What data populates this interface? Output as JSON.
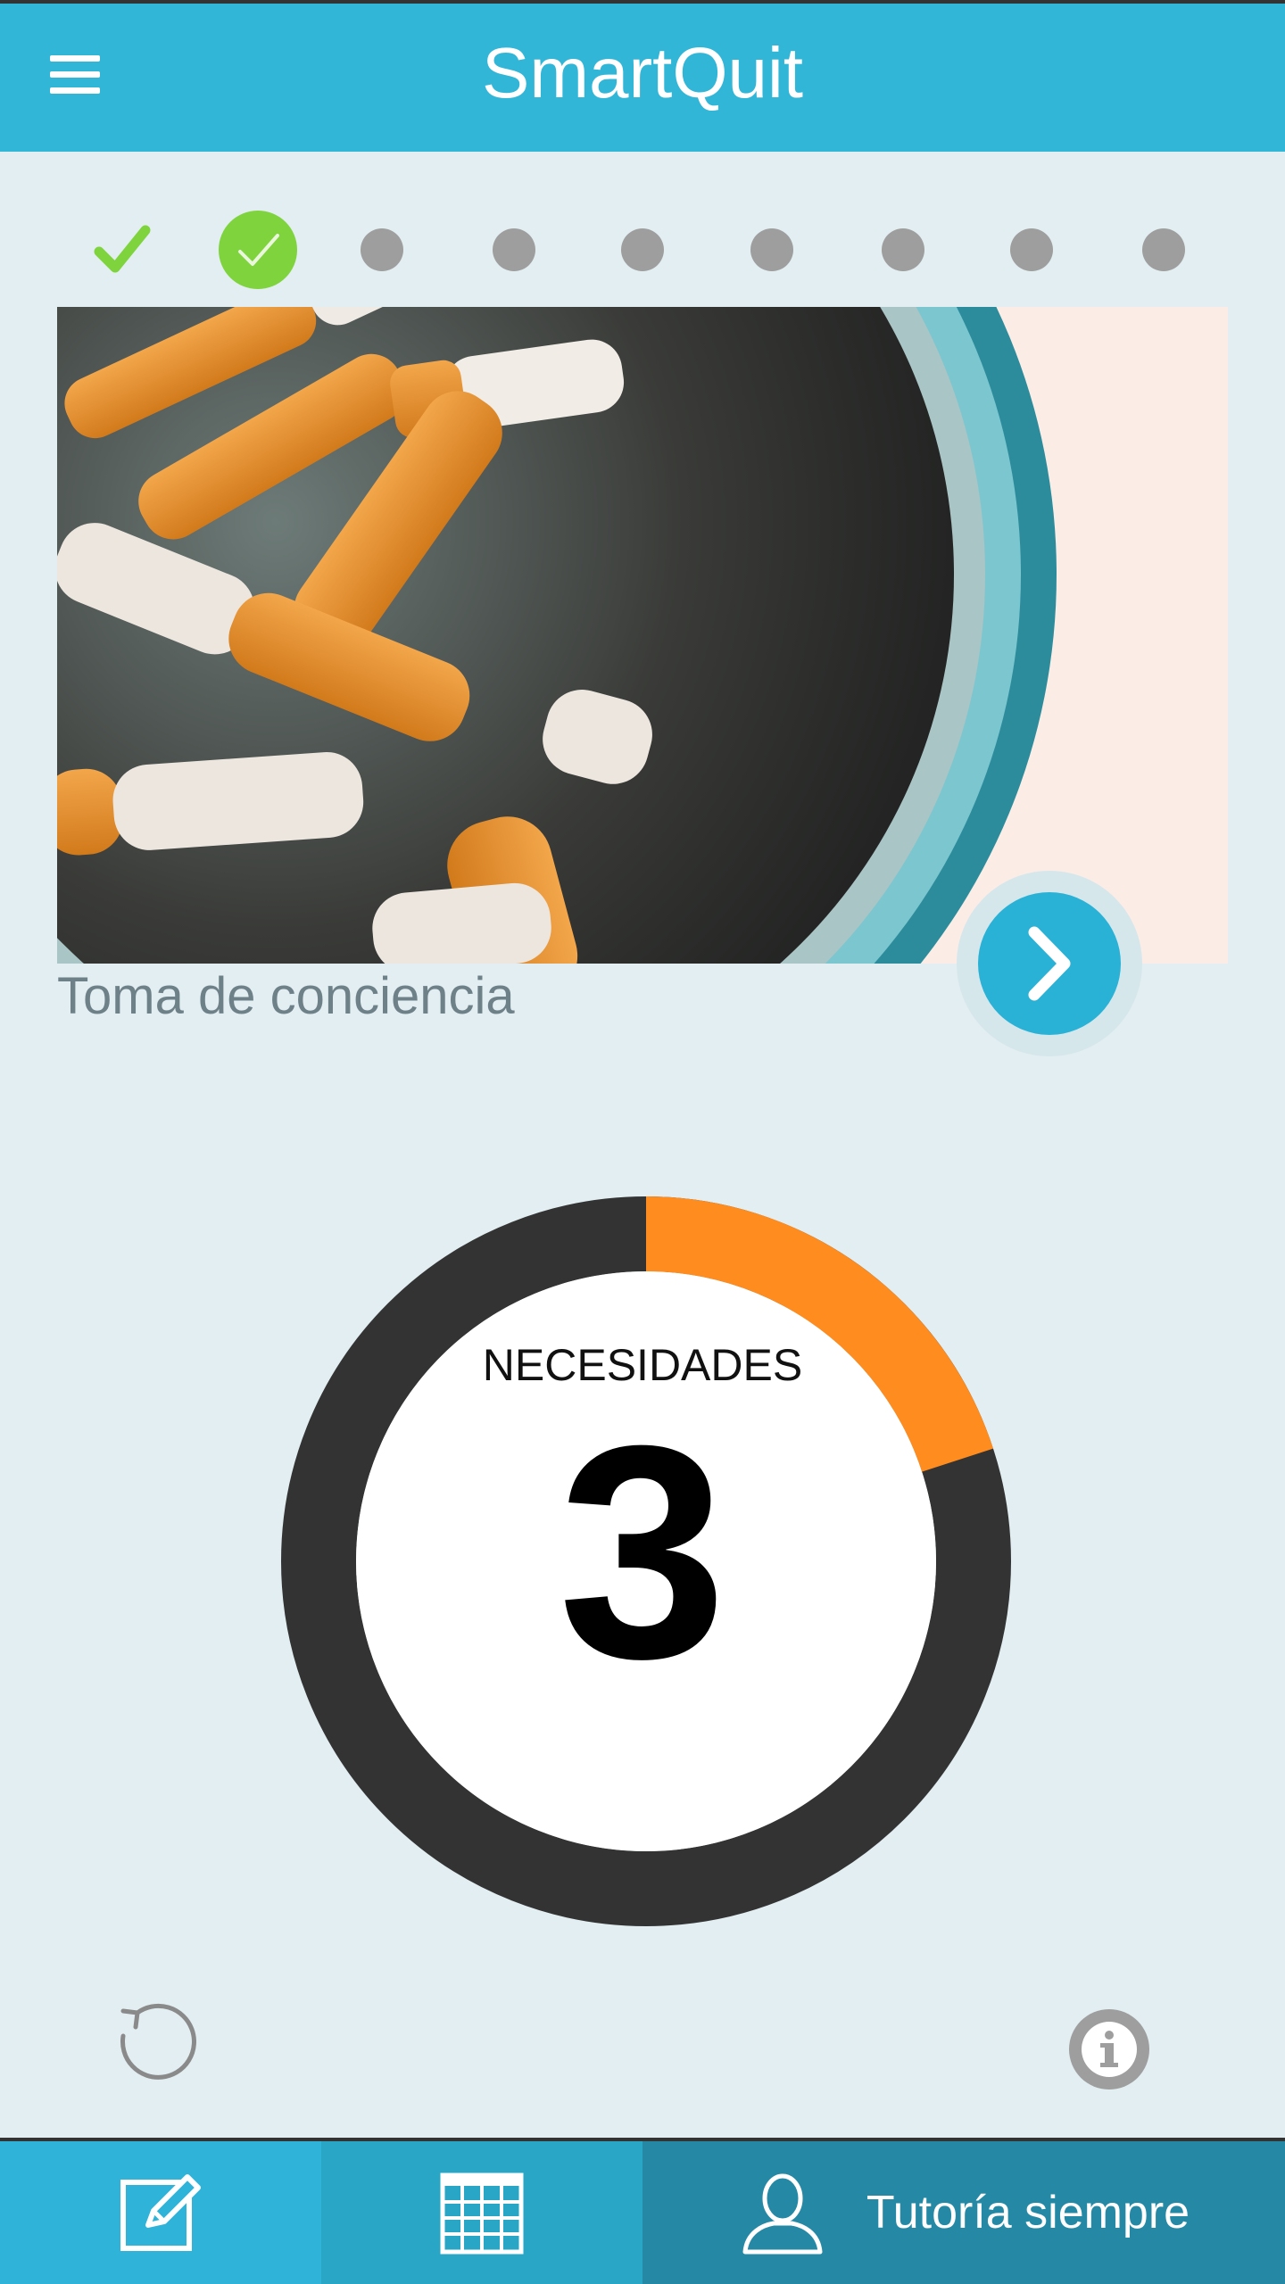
{
  "app": {
    "title": "SmartQuit"
  },
  "progress": {
    "total_steps": 9,
    "completed_steps": 1,
    "current_step": 2
  },
  "card": {
    "title": "Toma de conciencia"
  },
  "gauge": {
    "label": "NECESIDADES",
    "value": "3",
    "fraction": 0.2
  },
  "bottom_nav": {
    "tutoria_label": "Tutoría siempre"
  },
  "colors": {
    "app_bar": "#31b6d8",
    "background": "#e2eef1",
    "gauge_progress": "#ff8c1e",
    "gauge_track": "#333333",
    "step_done": "#7fd33d",
    "step_pending": "#9e9e9e"
  },
  "icons": [
    "menu-icon",
    "checkmark-icon",
    "chevron-right-icon",
    "reset-icon",
    "info-icon",
    "edit-icon",
    "calendar-icon",
    "user-icon"
  ]
}
